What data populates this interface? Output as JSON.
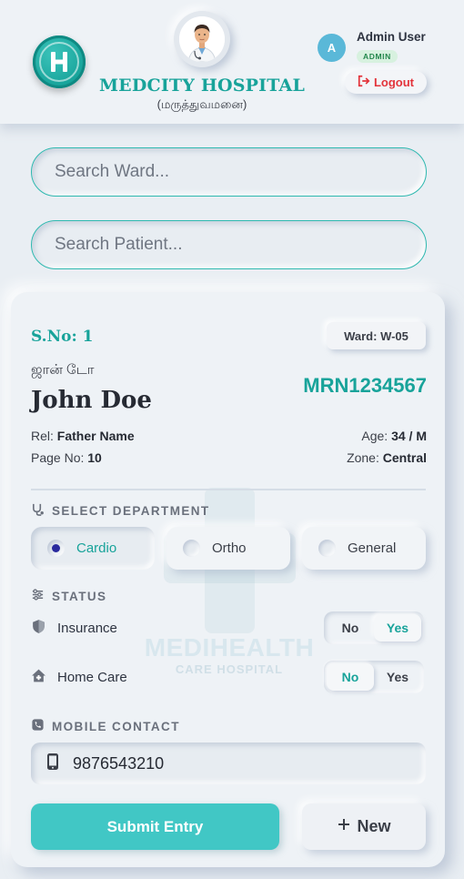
{
  "header": {
    "hospital_name": "MEDCITY HOSPITAL",
    "hospital_subtitle": "(மருத்துவமனை)",
    "user_initial": "A",
    "user_name": "Admin User",
    "user_role": "ADMIN",
    "logout_label": "Logout",
    "logo_icon": "hospital-h-icon",
    "avatar_icon": "doctor-avatar-icon"
  },
  "search": {
    "ward_placeholder": "Search Ward...",
    "patient_placeholder": "Search Patient..."
  },
  "patient": {
    "serial": "S.No: 1",
    "ward": "Ward: W-05",
    "name_tamil": "ஜான் டோ",
    "name": "John Doe",
    "mrn": "MRN1234567",
    "rel_label": "Rel:",
    "rel_value": "Father Name",
    "age_label": "Age:",
    "age_value": "34 / M",
    "page_label": "Page No:",
    "page_value": "10",
    "zone_label": "Zone:",
    "zone_value": "Central"
  },
  "watermark": {
    "line1": "MEDIHEALTH",
    "line2": "CARE HOSPITAL"
  },
  "department": {
    "section_label": "SELECT DEPARTMENT",
    "options": [
      "Cardio",
      "Ortho",
      "General"
    ],
    "selected": "Cardio"
  },
  "status": {
    "section_label": "STATUS",
    "insurance_label": "Insurance",
    "insurance_value": "Yes",
    "homecare_label": "Home Care",
    "homecare_value": "No",
    "no_label": "No",
    "yes_label": "Yes"
  },
  "mobile": {
    "section_label": "MOBILE CONTACT",
    "value": "9876543210"
  },
  "actions": {
    "submit_label": "Submit Entry",
    "new_label": "New"
  },
  "colors": {
    "accent": "#18a39a",
    "submit": "#41c7c5",
    "logout": "#e3343b",
    "background": "#e9eef3"
  }
}
